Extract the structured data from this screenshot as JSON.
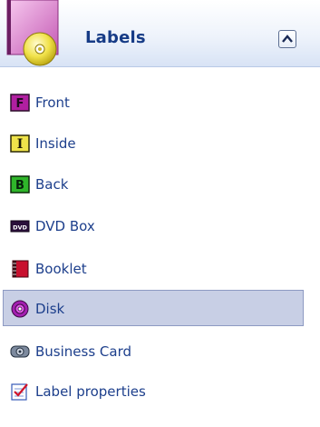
{
  "header": {
    "title": "Labels",
    "icon": "disc-folder-icon",
    "collapse_icon": "chevron-up-icon"
  },
  "items": [
    {
      "label": "Front",
      "icon": "front-icon",
      "icon_letter": "F",
      "selected": false
    },
    {
      "label": "Inside",
      "icon": "inside-icon",
      "icon_letter": "I",
      "selected": false
    },
    {
      "label": "Back",
      "icon": "back-icon",
      "icon_letter": "B",
      "selected": false
    },
    {
      "label": "DVD Box",
      "icon": "dvd-box-icon",
      "icon_letter": "DVD",
      "selected": false
    },
    {
      "label": "Booklet",
      "icon": "booklet-icon",
      "selected": false
    },
    {
      "label": "Disk",
      "icon": "disk-icon",
      "selected": true
    },
    {
      "label": "Business Card",
      "icon": "business-card-icon",
      "selected": false
    },
    {
      "label": "Label properties",
      "icon": "label-properties-icon",
      "selected": false
    }
  ],
  "colors": {
    "label_text": "#1d3f8c",
    "header_title": "#163b86",
    "selected_bg": "#c8cfe5",
    "selected_border": "#8d9ac2"
  }
}
